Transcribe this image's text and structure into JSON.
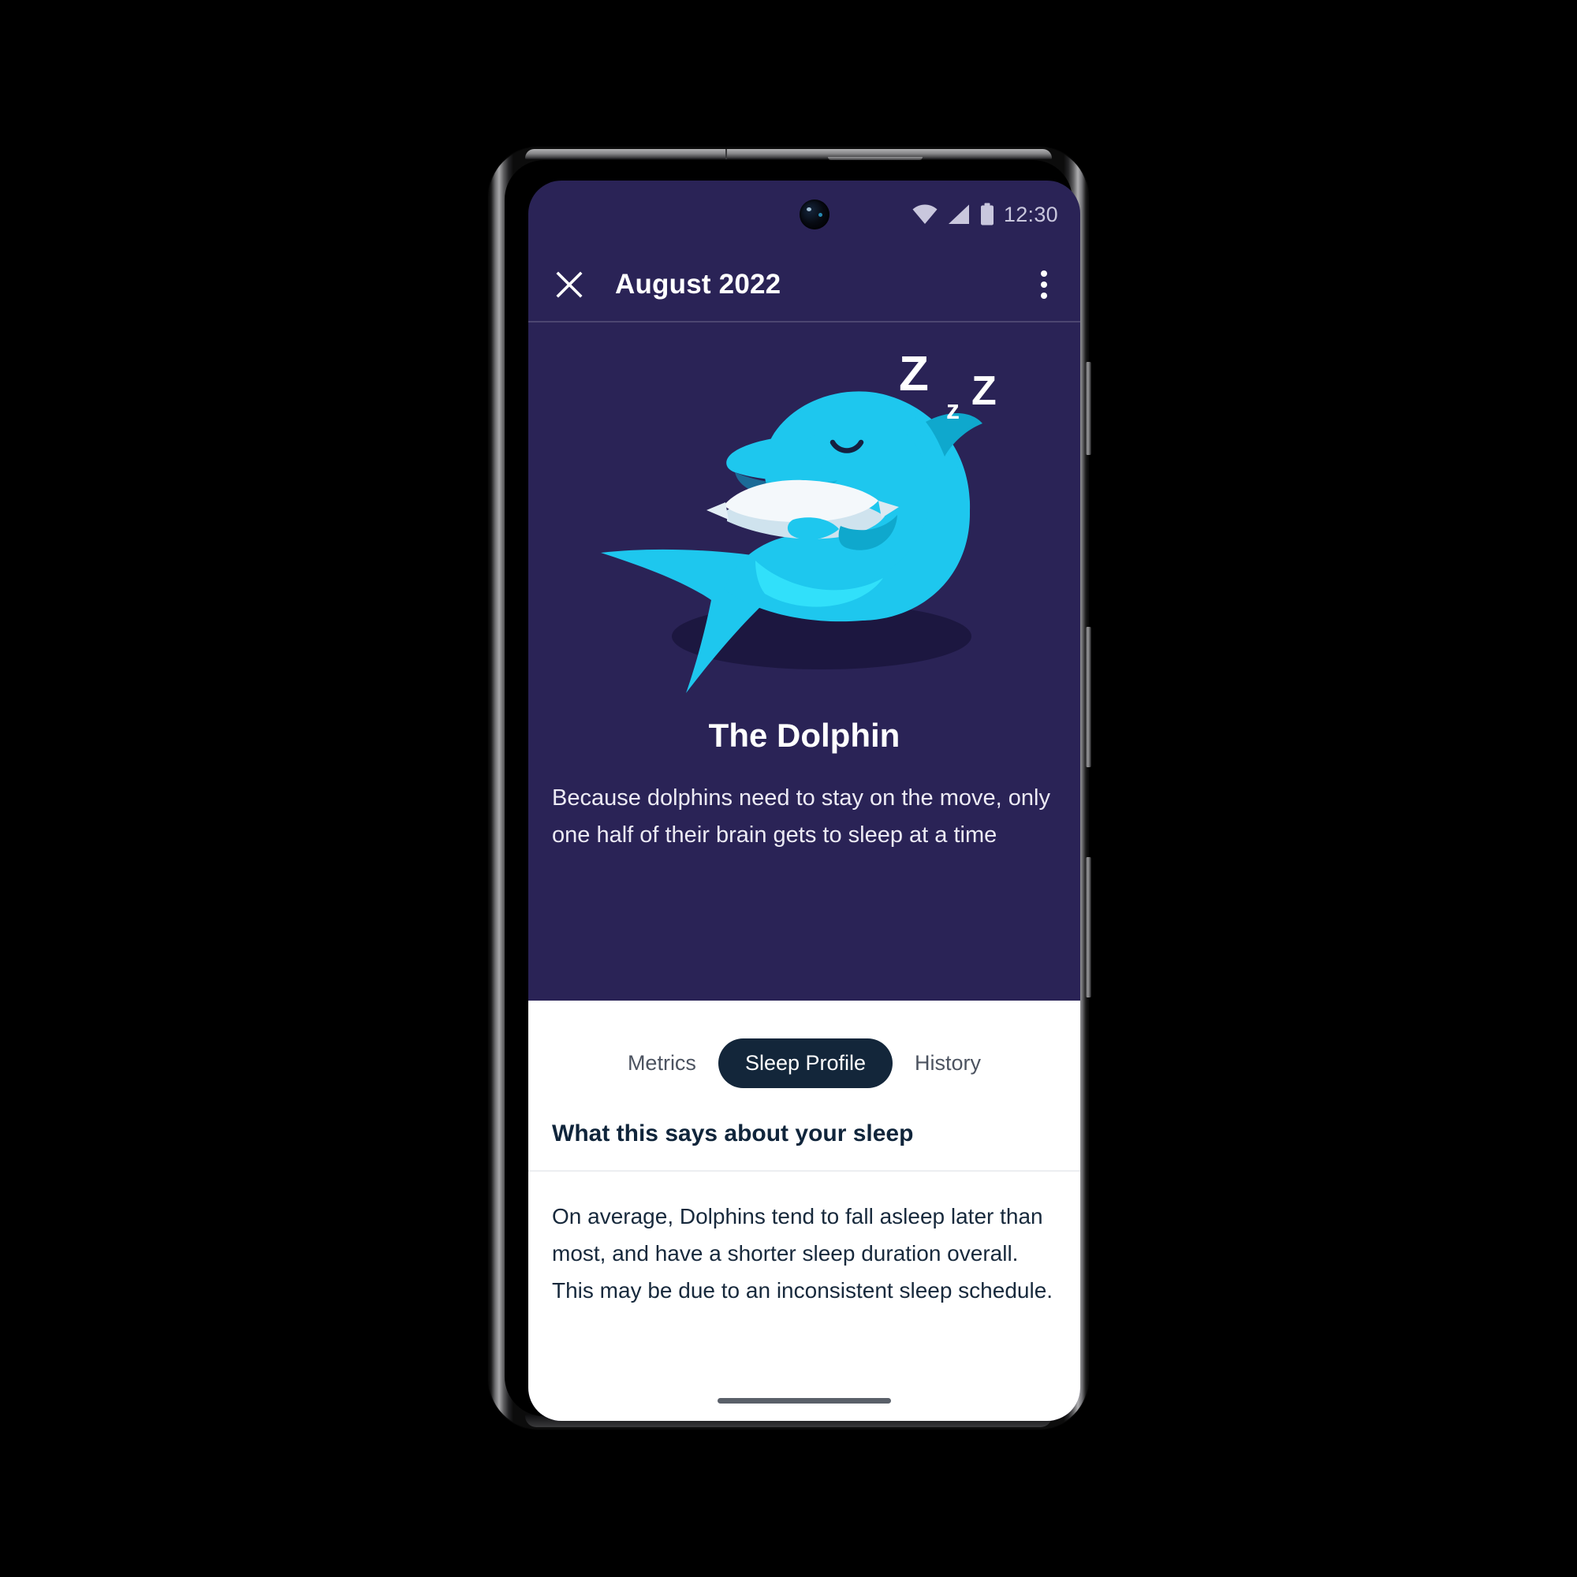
{
  "status_bar": {
    "time": "12:30",
    "icons": [
      "wifi-icon",
      "cellular-signal-icon",
      "battery-icon"
    ]
  },
  "app_bar": {
    "close_icon": "close-icon",
    "title": "August 2022",
    "overflow_icon": "more-vertical-icon"
  },
  "hero": {
    "illustration_name": "sleeping-dolphin-illustration",
    "sleep_zzz": [
      "Z",
      "z",
      "Z"
    ],
    "title": "The Dolphin",
    "description": "Because dolphins need to stay on the move, only one half of their brain gets to sleep at a time"
  },
  "tabs": [
    {
      "label": "Metrics",
      "active": false
    },
    {
      "label": "Sleep Profile",
      "active": true
    },
    {
      "label": "History",
      "active": false
    }
  ],
  "sheet": {
    "heading": "What this says about your sleep",
    "body": "On average, Dolphins tend to fall asleep later than most, and have a shorter sleep duration overall. This may be due to an inconsistent sleep schedule."
  },
  "colors": {
    "hero_background": "#2a2356",
    "sheet_background": "#ffffff",
    "accent_tab_active": "#13263a",
    "dolphin_body": "#1ec7ee",
    "dolphin_body_light": "#22d9f5",
    "dolphin_shade": "#159fbf",
    "pillow": "#f4f8fb",
    "shadow": "#1c1740",
    "status_text": "#c9c7dd"
  }
}
